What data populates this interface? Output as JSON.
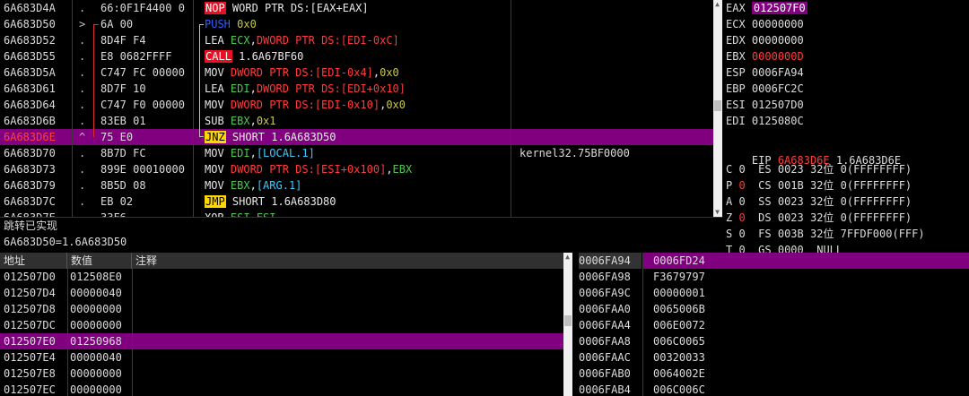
{
  "colors": {
    "accent": "#800080",
    "scrollbar": "#f0f0f0",
    "red": "#ff3c3c",
    "call_bg": "#e81123",
    "jump_bg": "#ffd700"
  },
  "disasm": {
    "rows": [
      {
        "addr": "6A683D4A",
        "mark": ".",
        "bytes": "66:0F1F4400 0",
        "mn": "NOP",
        "mnstyle": "red",
        "ops": [
          {
            "t": " WORD PTR DS:[EAX+EAX]",
            "c": "white"
          }
        ],
        "comment": ""
      },
      {
        "addr": "6A683D50",
        "mark": ">",
        "bytes": "6A 00",
        "mn": "PUSH",
        "mnstyle": "blue",
        "ops": [
          {
            "t": " 0x0",
            "c": "olive"
          }
        ],
        "comment": ""
      },
      {
        "addr": "6A683D52",
        "mark": ".",
        "bytes": "8D4F F4",
        "mn": "LEA",
        "mnstyle": "white",
        "ops": [
          {
            "t": " ECX",
            "c": "green"
          },
          {
            "t": ",",
            "c": "white"
          },
          {
            "t": "DWORD PTR DS:[EDI-0xC]",
            "c": "red"
          }
        ],
        "comment": ""
      },
      {
        "addr": "6A683D55",
        "mark": ".",
        "bytes": "E8 0682FFFF",
        "mn": "CALL",
        "mnstyle": "call",
        "ops": [
          {
            "t": " 1.6A67BF60",
            "c": "white"
          }
        ],
        "comment": ""
      },
      {
        "addr": "6A683D5A",
        "mark": ".",
        "bytes": "C747 FC 00000",
        "mn": "MOV",
        "mnstyle": "white",
        "ops": [
          {
            "t": " DWORD PTR DS:[EDI-0x4]",
            "c": "red"
          },
          {
            "t": ",",
            "c": "white"
          },
          {
            "t": "0x0",
            "c": "olive"
          }
        ],
        "comment": ""
      },
      {
        "addr": "6A683D61",
        "mark": ".",
        "bytes": "8D7F 10",
        "mn": "LEA",
        "mnstyle": "white",
        "ops": [
          {
            "t": " EDI",
            "c": "green"
          },
          {
            "t": ",",
            "c": "white"
          },
          {
            "t": "DWORD PTR DS:[EDI+0x10]",
            "c": "red"
          }
        ],
        "comment": ""
      },
      {
        "addr": "6A683D64",
        "mark": ".",
        "bytes": "C747 F0 00000",
        "mn": "MOV",
        "mnstyle": "white",
        "ops": [
          {
            "t": " DWORD PTR DS:[EDI-0x10]",
            "c": "red"
          },
          {
            "t": ",",
            "c": "white"
          },
          {
            "t": "0x0",
            "c": "olive"
          }
        ],
        "comment": ""
      },
      {
        "addr": "6A683D6B",
        "mark": ".",
        "bytes": "83EB 01",
        "mn": "SUB",
        "mnstyle": "white",
        "ops": [
          {
            "t": " EBX",
            "c": "green"
          },
          {
            "t": ",",
            "c": "white"
          },
          {
            "t": "0x1",
            "c": "olive"
          }
        ],
        "comment": ""
      },
      {
        "addr": "6A683D6E",
        "mark": "^",
        "bytes": "75 E0",
        "mn": "JNZ",
        "mnstyle": "jump",
        "ops": [
          {
            "t": " SHORT 1.6A683D50",
            "c": "white"
          }
        ],
        "comment": "",
        "selected": true
      },
      {
        "addr": "6A683D70",
        "mark": ".",
        "bytes": "8B7D FC",
        "mn": "MOV",
        "mnstyle": "white",
        "ops": [
          {
            "t": " EDI",
            "c": "green"
          },
          {
            "t": ",",
            "c": "white"
          },
          {
            "t": "[LOCAL.1]",
            "c": "cyan"
          }
        ],
        "comment": "kernel32.75BF0000"
      },
      {
        "addr": "6A683D73",
        "mark": ".",
        "bytes": "899E 00010000",
        "mn": "MOV",
        "mnstyle": "white",
        "ops": [
          {
            "t": " DWORD PTR DS:[ESI+0x100]",
            "c": "red"
          },
          {
            "t": ",",
            "c": "white"
          },
          {
            "t": "EBX",
            "c": "green"
          }
        ],
        "comment": ""
      },
      {
        "addr": "6A683D79",
        "mark": ".",
        "bytes": "8B5D 08",
        "mn": "MOV",
        "mnstyle": "white",
        "ops": [
          {
            "t": " EBX",
            "c": "green"
          },
          {
            "t": ",",
            "c": "white"
          },
          {
            "t": "[ARG.1]",
            "c": "cyan"
          }
        ],
        "comment": ""
      },
      {
        "addr": "6A683D7C",
        "mark": ".",
        "bytes": "EB 02",
        "mn": "JMP",
        "mnstyle": "jump",
        "ops": [
          {
            "t": " SHORT 1.6A683D80",
            "c": "white"
          }
        ],
        "comment": ""
      },
      {
        "addr": "6A683D7E",
        "mark": ".",
        "bytes": "33F6",
        "mn": "XOR",
        "mnstyle": "white",
        "ops": [
          {
            "t": " ESI",
            "c": "green"
          },
          {
            "t": ",",
            "c": "white"
          },
          {
            "t": "ESI",
            "c": "green"
          }
        ],
        "comment": ""
      }
    ]
  },
  "info": {
    "line1": "跳转已实现",
    "line2": "6A683D50=1.6A683D50"
  },
  "registers": {
    "gp": [
      {
        "name": "EAX",
        "value": "012507F0",
        "highlight": true
      },
      {
        "name": "ECX",
        "value": "00000000"
      },
      {
        "name": "EDX",
        "value": "00000000"
      },
      {
        "name": "EBX",
        "value": "0000000D",
        "changed": true
      },
      {
        "name": "ESP",
        "value": "0006FA94"
      },
      {
        "name": "EBP",
        "value": "0006FC2C"
      },
      {
        "name": "ESI",
        "value": "012507D0"
      },
      {
        "name": "EDI",
        "value": "0125080C"
      }
    ],
    "eip": {
      "name": "EIP",
      "value": "6A683D6E",
      "extra": "1.6A683D6E"
    },
    "flags": [
      {
        "flag": "C",
        "fv": "0",
        "seg": "ES",
        "sel": "0023",
        "bits": "32位",
        "desc": "0(FFFFFFFF)"
      },
      {
        "flag": "P",
        "fv": "0",
        "seg": "CS",
        "sel": "001B",
        "bits": "32位",
        "desc": "0(FFFFFFFF)",
        "changed": true
      },
      {
        "flag": "A",
        "fv": "0",
        "seg": "SS",
        "sel": "0023",
        "bits": "32位",
        "desc": "0(FFFFFFFF)"
      },
      {
        "flag": "Z",
        "fv": "0",
        "seg": "DS",
        "sel": "0023",
        "bits": "32位",
        "desc": "0(FFFFFFFF)",
        "changed": true
      },
      {
        "flag": "S",
        "fv": "0",
        "seg": "FS",
        "sel": "003B",
        "bits": "32位",
        "desc": "7FFDF000(FFF)"
      },
      {
        "flag": "T",
        "fv": "0",
        "seg": "GS",
        "sel": "0000",
        "bits": "",
        "desc": "NULL"
      }
    ]
  },
  "dump": {
    "headers": {
      "address": "地址",
      "value": "数值",
      "comment": "注释"
    },
    "rows": [
      {
        "addr": "012507D0",
        "value": "012508E0"
      },
      {
        "addr": "012507D4",
        "value": "00000040"
      },
      {
        "addr": "012507D8",
        "value": "00000000"
      },
      {
        "addr": "012507DC",
        "value": "00000000"
      },
      {
        "addr": "012507E0",
        "value": "01250968",
        "selected": true
      },
      {
        "addr": "012507E4",
        "value": "00000040"
      },
      {
        "addr": "012507E8",
        "value": "00000000"
      },
      {
        "addr": "012507EC",
        "value": "00000000"
      }
    ]
  },
  "stack": {
    "rows": [
      {
        "addr": "0006FA94",
        "value": "0006FD24",
        "selected": true
      },
      {
        "addr": "0006FA98",
        "value": "F3679797"
      },
      {
        "addr": "0006FA9C",
        "value": "00000001"
      },
      {
        "addr": "0006FAA0",
        "value": "0065006B"
      },
      {
        "addr": "0006FAA4",
        "value": "006E0072"
      },
      {
        "addr": "0006FAA8",
        "value": "006C0065"
      },
      {
        "addr": "0006FAAC",
        "value": "00320033"
      },
      {
        "addr": "0006FAB0",
        "value": "0064002E"
      },
      {
        "addr": "0006FAB4",
        "value": "006C006C"
      }
    ]
  }
}
